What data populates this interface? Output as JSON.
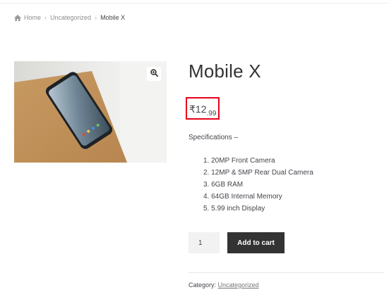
{
  "breadcrumb": {
    "home": "Home",
    "category": "Uncategorized",
    "current": "Mobile X"
  },
  "product": {
    "title": "Mobile X",
    "price_main": "₹12",
    "price_cents": ".99",
    "spec_heading": "Specifications –",
    "specs": [
      "1. 20MP Front Camera",
      "2. 12MP & 5MP Rear Dual Camera",
      "3. 6GB RAM",
      "4. 64GB Internal Memory",
      "5. 5.99 inch Display"
    ],
    "quantity": "1",
    "add_to_cart_label": "Add to cart",
    "category_label": "Category:",
    "category_value": "Uncategorized"
  },
  "icons": {
    "home": "home-icon",
    "zoom": "zoom-icon"
  },
  "colors": {
    "highlight": "#e8001c",
    "button": "#333333"
  }
}
